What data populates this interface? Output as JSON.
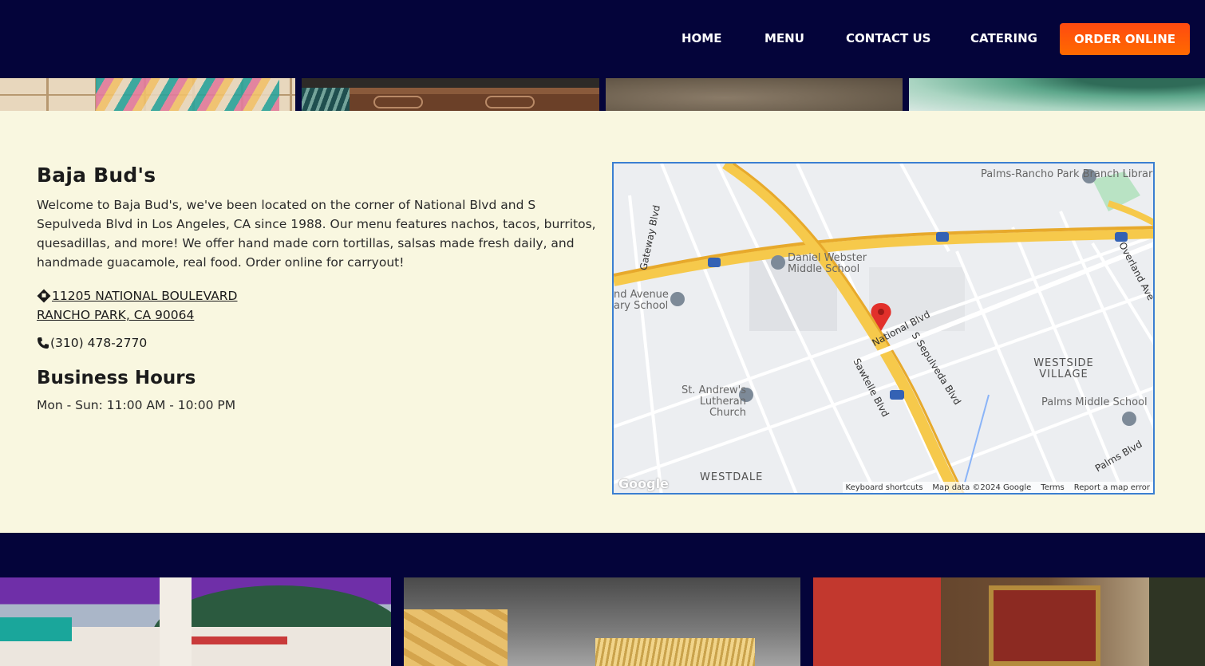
{
  "nav": {
    "home": "HOME",
    "menu": "MENU",
    "contact": "CONTACT US",
    "catering": "CATERING",
    "order": "ORDER ONLINE"
  },
  "business": {
    "name": "Baja Bud's",
    "description": "Welcome to Baja Bud's, we've been located on the corner of National Blvd and S Sepulveda Blvd in Los Angeles, CA since 1988. Our menu features nachos, tacos, burritos, quesadillas, and more! We offer hand made corn tortillas, salsas made fresh daily, and handmade guacamole, real food. Order online for carryout!",
    "address_line1": "11205 NATIONAL BOULEVARD",
    "address_line2": "RANCHO PARK, CA 90064",
    "phone": "(310) 478-2770",
    "hours_heading": "Business Hours",
    "hours": "Mon - Sun: 11:00 AM - 10:00 PM"
  },
  "map": {
    "labels": {
      "palms_library": "Palms-Rancho Park Branch Library",
      "daniel_webster": "Daniel Webster Middle School",
      "avenue_school": "nd Avenue ary School",
      "st_andrews": "St. Andrew's Lutheran Church",
      "westside_village": "WESTSIDE VILLAGE",
      "westdale": "WESTDALE",
      "palms_middle": "Palms Middle School",
      "national_blvd": "National Blvd",
      "sepulveda": "S Sepulveda Blvd",
      "sawtelle": "Sawtelle Blvd",
      "overland": "Overland Ave",
      "palms_blvd": "Palms Blvd",
      "gateway": "Gateway Blvd"
    },
    "footer": {
      "shortcuts": "Keyboard shortcuts",
      "data": "Map data ©2024 Google",
      "terms": "Terms",
      "report": "Report a map error"
    },
    "logo": "Google"
  },
  "colors": {
    "navy": "#04043a",
    "cream": "#f9f7e0",
    "order_button": "#ff5a0a",
    "map_border": "#3b7fd1"
  }
}
